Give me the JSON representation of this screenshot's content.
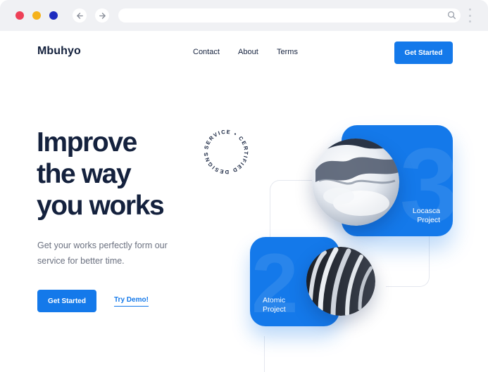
{
  "colors": {
    "accent": "#1479ea",
    "heading": "#14213d",
    "body_text": "#6b7180",
    "chrome_bg": "#f0f1f4",
    "traffic_red": "#ee4057",
    "traffic_yellow": "#f5b21b",
    "traffic_blue": "#1d2bbf"
  },
  "browser": {
    "back_icon": "arrow-left-icon",
    "forward_icon": "arrow-right-icon",
    "url_search_icon": "search-icon",
    "menu_icon": "kebab-menu-icon"
  },
  "header": {
    "logo": "Mbuhyo",
    "nav": [
      {
        "label": "Contact"
      },
      {
        "label": "About"
      },
      {
        "label": "Terms"
      }
    ],
    "cta_label": "Get Started"
  },
  "hero": {
    "headline_lines": [
      "Improve",
      "the way",
      "you works"
    ],
    "subtext": "Get your works perfectly form our service for better time.",
    "cta_label": "Get Started",
    "secondary_label": "Try Demo!"
  },
  "badge": {
    "text": "SERVICE • CERTIFIED DESIGNS"
  },
  "cards": [
    {
      "number": "3",
      "line1": "Locasca",
      "line2": "Project"
    },
    {
      "number": "2",
      "line1": "Atomic",
      "line2": "Project"
    }
  ]
}
